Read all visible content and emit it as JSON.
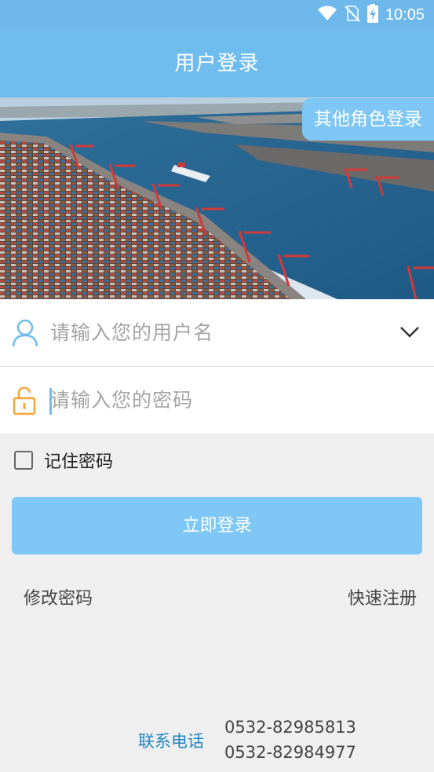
{
  "status_bar": {
    "time": "10:05"
  },
  "app_bar": {
    "title": "用户登录"
  },
  "banner": {
    "other_role_button": "其他角色登录"
  },
  "form": {
    "username_placeholder": "请输入您的用户名",
    "password_placeholder": "请输入您的密码",
    "remember_label": "记住密码",
    "remember_checked": false,
    "login_button": "立即登录"
  },
  "links": {
    "change_password": "修改密码",
    "quick_register": "快速注册"
  },
  "contact": {
    "label": "联系电话",
    "phones": [
      "0532-82985813",
      "0532-82984977"
    ]
  },
  "colors": {
    "primary": "#6fbcef",
    "button": "#7ec7f6",
    "contact_label": "#1f87c0",
    "lock_icon": "#f3a63a"
  }
}
